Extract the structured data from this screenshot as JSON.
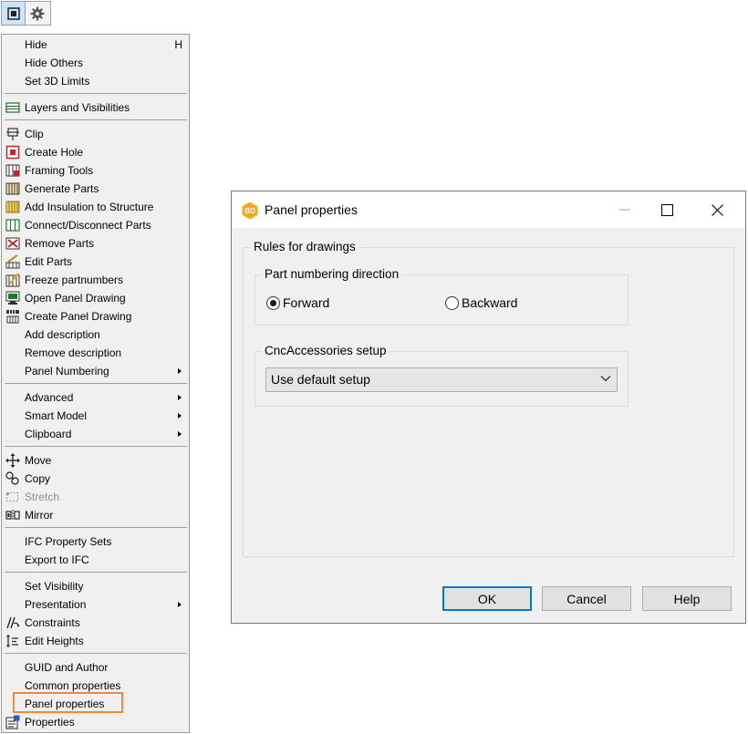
{
  "toolbar": {
    "buttons": [
      {
        "icon": "window-icon",
        "active": true
      },
      {
        "icon": "gear-icon",
        "active": false
      }
    ]
  },
  "menu": {
    "items": [
      {
        "label": "Hide",
        "shortcut": "H"
      },
      {
        "label": "Hide Others"
      },
      {
        "label": "Set 3D Limits"
      },
      {
        "label": "Layers and Visibilities",
        "icon": "layers-icon"
      },
      {
        "label": "Clip",
        "icon": "clip-icon"
      },
      {
        "label": "Create Hole",
        "icon": "create-hole-icon"
      },
      {
        "label": "Framing Tools",
        "icon": "framing-tools-icon"
      },
      {
        "label": "Generate Parts",
        "icon": "generate-parts-icon"
      },
      {
        "label": "Add Insulation to Structure",
        "icon": "insulation-icon"
      },
      {
        "label": "Connect/Disconnect Parts",
        "icon": "connect-parts-icon"
      },
      {
        "label": "Remove Parts",
        "icon": "remove-parts-icon"
      },
      {
        "label": "Edit Parts",
        "icon": "edit-parts-icon"
      },
      {
        "label": "Freeze partnumbers",
        "icon": "freeze-icon"
      },
      {
        "label": "Open Panel Drawing",
        "icon": "open-drawing-icon"
      },
      {
        "label": "Create Panel Drawing",
        "icon": "build-icon"
      },
      {
        "label": "Add description"
      },
      {
        "label": "Remove description"
      },
      {
        "label": "Panel Numbering",
        "submenu": true
      },
      {
        "label": "Advanced",
        "submenu": true
      },
      {
        "label": "Smart Model",
        "submenu": true
      },
      {
        "label": "Clipboard",
        "submenu": true
      },
      {
        "label": "Move",
        "icon": "move-icon"
      },
      {
        "label": "Copy",
        "icon": "copy-icon"
      },
      {
        "label": "Stretch",
        "icon": "stretch-icon",
        "disabled": true
      },
      {
        "label": "Mirror",
        "icon": "mirror-icon"
      },
      {
        "label": "IFC Property Sets"
      },
      {
        "label": "Export to IFC"
      },
      {
        "label": "Set Visibility"
      },
      {
        "label": "Presentation",
        "submenu": true
      },
      {
        "label": "Constraints",
        "icon": "constraints-icon"
      },
      {
        "label": "Edit Heights",
        "icon": "edit-heights-icon"
      },
      {
        "label": "GUID and Author"
      },
      {
        "label": "Common properties"
      },
      {
        "label": "Panel properties",
        "highlighted": true
      },
      {
        "label": "Properties",
        "icon": "properties-icon"
      }
    ]
  },
  "dialog": {
    "title": "Panel properties",
    "app_icon_text": "BD",
    "rules_group": "Rules for drawings",
    "numbering_group": "Part numbering direction",
    "forward": "Forward",
    "backward": "Backward",
    "selected_direction": "Forward",
    "cnc_group": "CncAccessories setup",
    "cnc_value": "Use default setup",
    "ok": "OK",
    "cancel": "Cancel",
    "help": "Help"
  },
  "colors": {
    "highlight_border": "#f0883c",
    "default_button_border": "#0078d7",
    "app_badge": "#f5a623"
  }
}
